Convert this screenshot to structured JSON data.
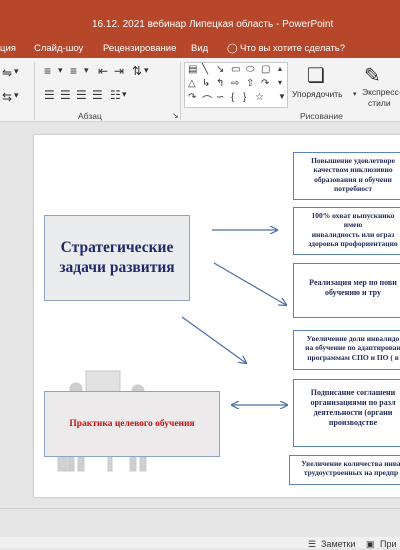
{
  "window": {
    "title": "16.12. 2021 вебинар Липецкая область  -  PowerPoint"
  },
  "menu": {
    "items": [
      "ция",
      "Слайд-шоу",
      "Рецензирование",
      "Вид"
    ],
    "tell_me": "Что вы хотите сделать?"
  },
  "ribbon": {
    "paragraph_label": "Абзац",
    "drawing_label": "Рисование",
    "arrange_label": "Упорядочить",
    "quick_styles_label_1": "Экспресс-",
    "quick_styles_label_2": "стили"
  },
  "slide": {
    "strategic": "Стратегические задачи развития",
    "practice": "Практика целевого обучения",
    "right_boxes": [
      [
        "Повышение удовлетворе",
        "качеством инклюзивно",
        "образования и обучени",
        "потребност"
      ],
      [
        "100% охват выпускнико",
        "имею",
        "инвалидность  или ограз",
        "здоровья профориентацио"
      ],
      [
        "Реализация мер по пови",
        "обучению и тру"
      ],
      [
        "Увеличение доли инвалидо",
        "на обучение по адаптирован",
        "программам СПО  и  ПО ( в"
      ],
      [
        "Подписание соглашени",
        "организациями по разл",
        "деятельности (органи",
        "производстве"
      ],
      [
        "Увеличение количества инва",
        "трудоустроенных на предпр"
      ]
    ]
  },
  "status": {
    "notes": "Заметки",
    "comments": "При"
  },
  "colors": {
    "accent": "#b7472a",
    "box_border": "#5b82bd",
    "practice_text": "#cc1111",
    "title_text": "#1f2a6b"
  }
}
